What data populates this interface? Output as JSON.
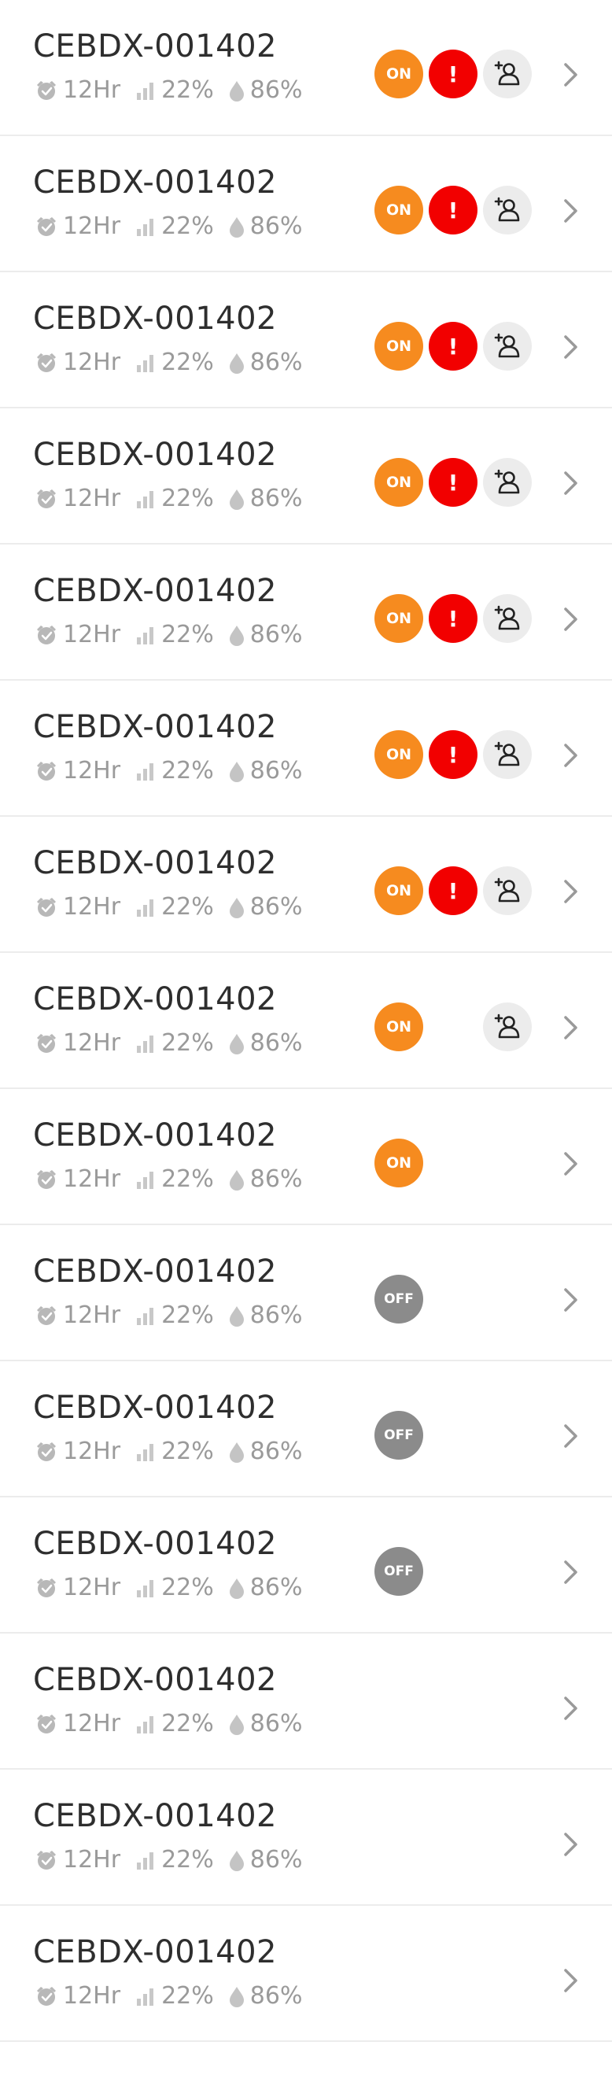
{
  "devices": [
    {
      "name": "CEBDX-001402",
      "timer": "12Hr",
      "signal": "22%",
      "humidity": "86%",
      "status": "ON",
      "alert": "!",
      "share": true
    },
    {
      "name": "CEBDX-001402",
      "timer": "12Hr",
      "signal": "22%",
      "humidity": "86%",
      "status": "ON",
      "alert": "!",
      "share": true
    },
    {
      "name": "CEBDX-001402",
      "timer": "12Hr",
      "signal": "22%",
      "humidity": "86%",
      "status": "ON",
      "alert": "!",
      "share": true
    },
    {
      "name": "CEBDX-001402",
      "timer": "12Hr",
      "signal": "22%",
      "humidity": "86%",
      "status": "ON",
      "alert": "!",
      "share": true
    },
    {
      "name": "CEBDX-001402",
      "timer": "12Hr",
      "signal": "22%",
      "humidity": "86%",
      "status": "ON",
      "alert": "!",
      "share": true
    },
    {
      "name": "CEBDX-001402",
      "timer": "12Hr",
      "signal": "22%",
      "humidity": "86%",
      "status": "ON",
      "alert": "!",
      "share": true
    },
    {
      "name": "CEBDX-001402",
      "timer": "12Hr",
      "signal": "22%",
      "humidity": "86%",
      "status": "ON",
      "alert": "!",
      "share": true
    },
    {
      "name": "CEBDX-001402",
      "timer": "12Hr",
      "signal": "22%",
      "humidity": "86%",
      "status": "ON",
      "alert": null,
      "share": true
    },
    {
      "name": "CEBDX-001402",
      "timer": "12Hr",
      "signal": "22%",
      "humidity": "86%",
      "status": "ON",
      "alert": null,
      "share": false
    },
    {
      "name": "CEBDX-001402",
      "timer": "12Hr",
      "signal": "22%",
      "humidity": "86%",
      "status": "OFF",
      "alert": null,
      "share": false
    },
    {
      "name": "CEBDX-001402",
      "timer": "12Hr",
      "signal": "22%",
      "humidity": "86%",
      "status": "OFF",
      "alert": null,
      "share": false
    },
    {
      "name": "CEBDX-001402",
      "timer": "12Hr",
      "signal": "22%",
      "humidity": "86%",
      "status": "OFF",
      "alert": null,
      "share": false
    },
    {
      "name": "CEBDX-001402",
      "timer": "12Hr",
      "signal": "22%",
      "humidity": "86%",
      "status": null,
      "alert": null,
      "share": false
    },
    {
      "name": "CEBDX-001402",
      "timer": "12Hr",
      "signal": "22%",
      "humidity": "86%",
      "status": null,
      "alert": null,
      "share": false
    },
    {
      "name": "CEBDX-001402",
      "timer": "12Hr",
      "signal": "22%",
      "humidity": "86%",
      "status": null,
      "alert": null,
      "share": false
    }
  ],
  "icons": {
    "timer": "alarm-clock-icon",
    "signal": "signal-bars-icon",
    "humidity": "water-drop-icon",
    "share": "add-user-icon",
    "open": "chevron-right-icon"
  },
  "colors": {
    "on": "#f68b1f",
    "off": "#8b8b8b",
    "alert": "#f20000",
    "meta": "#9a9a9a"
  }
}
